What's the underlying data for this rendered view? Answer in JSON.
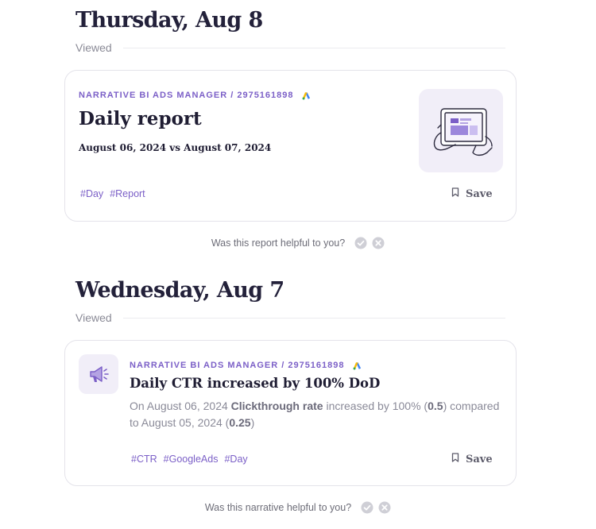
{
  "sections": [
    {
      "date_heading": "Thursday, Aug 8",
      "viewed_label": "Viewed",
      "card": {
        "source": "NARRATIVE BI ADS MANAGER / 2975161898",
        "title": "Daily report",
        "date_range": "August 06, 2024 vs August 07, 2024",
        "tags": [
          "#Day",
          "#Report"
        ],
        "save_label": "Save",
        "icons": {
          "source": "google-ads-icon",
          "thumbnail": "tablet-illustration",
          "save": "bookmark-icon"
        }
      },
      "feedback": {
        "question": "Was this report helpful to you?",
        "icons": [
          "check-circle-icon",
          "x-circle-icon"
        ]
      }
    },
    {
      "date_heading": "Wednesday, Aug 7",
      "viewed_label": "Viewed",
      "card": {
        "source": "NARRATIVE BI ADS MANAGER / 2975161898",
        "title": "Daily CTR increased by 100% DoD",
        "body": {
          "part1": "On August 06, 2024 ",
          "metric": "Clickthrough rate",
          "part2": " increased by 100% (",
          "value1": "0.5",
          "part3": ") compared to August 05, 2024 (",
          "value2": "0.25",
          "part4": ")"
        },
        "tags": [
          "#CTR",
          "#GoogleAds",
          "#Day"
        ],
        "save_label": "Save",
        "icons": {
          "type": "megaphone-icon",
          "source": "google-ads-icon",
          "save": "bookmark-icon"
        }
      },
      "feedback": {
        "question": "Was this narrative helpful to you?",
        "icons": [
          "check-circle-icon",
          "x-circle-icon"
        ]
      }
    }
  ],
  "colors": {
    "accent": "#7b5fc7",
    "heading": "#23213a",
    "muted": "#8a8a96",
    "icon_bg": "#f1eef8"
  }
}
